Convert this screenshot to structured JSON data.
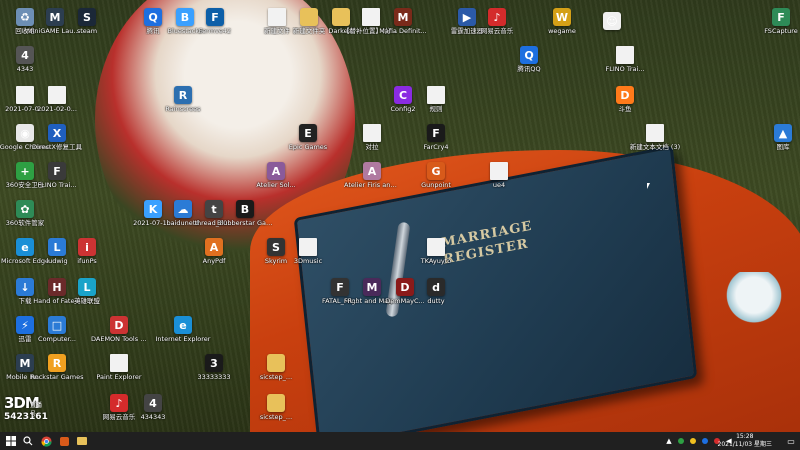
{
  "desktop": {
    "book": {
      "title_line1": "MARRIAGE",
      "title_line2": "REGISTER"
    },
    "icons": [
      {
        "label": "回收站",
        "type": "app",
        "color": "#6d8fb5",
        "glyph": "♻"
      },
      {
        "label": "MiniGAME Launcher",
        "type": "app",
        "color": "#2c3e50",
        "glyph": "M"
      },
      {
        "label": "steam",
        "type": "app",
        "color": "#1b2838",
        "glyph": "S"
      },
      {
        "label": "腾讯",
        "type": "app",
        "color": "#1d6fe0",
        "glyph": "Q"
      },
      {
        "label": "Bluestacks",
        "type": "app",
        "color": "#3aa0ff",
        "glyph": "B"
      },
      {
        "label": "Fermve42",
        "type": "app",
        "color": "#0d5fa8",
        "glyph": "F"
      },
      {
        "label": "新建文件",
        "type": "file",
        "color": "#f2f2f2",
        "glyph": ""
      },
      {
        "label": "新建文件夹",
        "type": "folder",
        "color": "#e8c15a",
        "glyph": ""
      },
      {
        "label": "Darkest",
        "type": "folder",
        "color": "#e8c15a",
        "glyph": ""
      },
      {
        "label": "【替补位置】(分析版)",
        "type": "file",
        "color": "#f2f2f2",
        "glyph": ""
      },
      {
        "label": "Mafia Definit...",
        "type": "app",
        "color": "#7a2a1a",
        "glyph": "M"
      },
      {
        "label": "雷霆加速器",
        "type": "app",
        "color": "#2b5aa8",
        "glyph": "▶"
      },
      {
        "label": "网易云音乐",
        "type": "app",
        "color": "#d42b2b",
        "glyph": "♪"
      },
      {
        "label": "wegame",
        "type": "app",
        "color": "#d4a017",
        "glyph": "W"
      },
      {
        "label": "",
        "type": "app",
        "color": "#f0f0f0",
        "glyph": "☺"
      },
      {
        "label": "FSCapture",
        "type": "app",
        "color": "#2e8b57",
        "glyph": "F"
      },
      {
        "label": "4343",
        "type": "app",
        "color": "#555555",
        "glyph": "4"
      },
      {
        "label": "腾讯QQ",
        "type": "app",
        "color": "#1d6fe0",
        "glyph": "Q"
      },
      {
        "label": "FLINO Trai...",
        "type": "file",
        "color": "#f2f2f2",
        "glyph": ""
      },
      {
        "label": "2021-07-0...",
        "type": "file",
        "color": "#f2f2f2",
        "glyph": ""
      },
      {
        "label": "2021-02-0...",
        "type": "file",
        "color": "#f2f2f2",
        "glyph": ""
      },
      {
        "label": "Rainscrees",
        "type": "app",
        "color": "#2c6fb0",
        "glyph": "R"
      },
      {
        "label": "Config2",
        "type": "app",
        "color": "#8a2be2",
        "glyph": "C"
      },
      {
        "label": "规则",
        "type": "file",
        "color": "#f2f2f2",
        "glyph": ""
      },
      {
        "label": "斗鱼",
        "type": "app",
        "color": "#ff7a1a",
        "glyph": "D"
      },
      {
        "label": "Google Chrome",
        "type": "app",
        "color": "#e8e8e8",
        "glyph": "◉"
      },
      {
        "label": "DirectX修复工具",
        "type": "app",
        "color": "#1f5fbf",
        "glyph": "X"
      },
      {
        "label": "Epic Games",
        "type": "app",
        "color": "#222222",
        "glyph": "E"
      },
      {
        "label": "对拉",
        "type": "file",
        "color": "#f2f2f2",
        "glyph": ""
      },
      {
        "label": "FarCry4",
        "type": "app",
        "color": "#1a1a1a",
        "glyph": "F"
      },
      {
        "label": "新建文本文档 (3)",
        "type": "file",
        "color": "#f2f2f2",
        "glyph": ""
      },
      {
        "label": "图库",
        "type": "app",
        "color": "#2b7bd6",
        "glyph": "▲"
      },
      {
        "label": "360安全卫士",
        "type": "app",
        "color": "#2ea043",
        "glyph": "+"
      },
      {
        "label": "FLINO Trai...",
        "type": "app",
        "color": "#3a3a3a",
        "glyph": "F"
      },
      {
        "label": "Atelier Sol...",
        "type": "app",
        "color": "#8a5a9a",
        "glyph": "A"
      },
      {
        "label": "Atelier Firis and Sophie",
        "type": "app",
        "color": "#b07aa0",
        "glyph": "A"
      },
      {
        "label": "Gunpoint",
        "type": "app",
        "color": "#d85a1a",
        "glyph": "G"
      },
      {
        "label": "ue4",
        "type": "file",
        "color": "#e8c15a",
        "glyph": ""
      },
      {
        "label": "360软件管家",
        "type": "app",
        "color": "#2e8b57",
        "glyph": "✿"
      },
      {
        "label": "2021-07-1...",
        "type": "app",
        "color": "#3aa0ff",
        "glyph": "K"
      },
      {
        "label": "baidunetd",
        "type": "app",
        "color": "#2b7bd6",
        "glyph": "☁"
      },
      {
        "label": "thread_30...",
        "type": "app",
        "color": "#444444",
        "glyph": "t"
      },
      {
        "label": "Blubberstar Gaming",
        "type": "app",
        "color": "#1a1a1a",
        "glyph": "B"
      },
      {
        "label": "Microsoft Edge",
        "type": "app",
        "color": "#1a8fd6",
        "glyph": "e"
      },
      {
        "label": "ludwig",
        "type": "app",
        "color": "#2b7bd6",
        "glyph": "L"
      },
      {
        "label": "ifunPs",
        "type": "app",
        "color": "#c33",
        "glyph": "i"
      },
      {
        "label": "AnyPdf",
        "type": "app",
        "color": "#e07020",
        "glyph": "A"
      },
      {
        "label": "Skyrim",
        "type": "app",
        "color": "#333333",
        "glyph": "S"
      },
      {
        "label": "3Dmusic",
        "type": "file",
        "color": "#f2f2f2",
        "glyph": ""
      },
      {
        "label": "TKAyuyto",
        "type": "file",
        "color": "#f2f2f2",
        "glyph": ""
      },
      {
        "label": "下载",
        "type": "app",
        "color": "#2b7bd6",
        "glyph": "↓"
      },
      {
        "label": "Hand of Fate 2",
        "type": "app",
        "color": "#6b2a2a",
        "glyph": "H"
      },
      {
        "label": "英雄联盟",
        "type": "app",
        "color": "#1aa3c9",
        "glyph": "L"
      },
      {
        "label": "Might and Magic H...",
        "type": "app",
        "color": "#4a2a5a",
        "glyph": "M"
      },
      {
        "label": "DemMayC...",
        "type": "app",
        "color": "#8a1a1a",
        "glyph": "D"
      },
      {
        "label": "dutty",
        "type": "app",
        "color": "#2a2a2a",
        "glyph": "d"
      },
      {
        "label": "FATAL_FR...",
        "type": "app",
        "color": "#333333",
        "glyph": "F"
      },
      {
        "label": "迅雷",
        "type": "app",
        "color": "#1d6fe0",
        "glyph": "⚡"
      },
      {
        "label": "Computer...",
        "type": "app",
        "color": "#2b7bd6",
        "glyph": "□"
      },
      {
        "label": "DAEMON Tools Lite",
        "type": "app",
        "color": "#cc3333",
        "glyph": "D"
      },
      {
        "label": "Internet Explorer",
        "type": "app",
        "color": "#1a8fd6",
        "glyph": "e"
      },
      {
        "label": "Mobile Re...",
        "type": "app",
        "color": "#2c3e50",
        "glyph": "M"
      },
      {
        "label": "Rockstar Games",
        "type": "app",
        "color": "#f0a020",
        "glyph": "R"
      },
      {
        "label": "Paint Explorer",
        "type": "file",
        "color": "#f2f2f2",
        "glyph": ""
      },
      {
        "label": "33333333",
        "type": "app",
        "color": "#1a1a1a",
        "glyph": "3"
      },
      {
        "label": "sicstep_...",
        "type": "folder",
        "color": "#e8c15a",
        "glyph": ""
      },
      {
        "label": "网易云音乐",
        "type": "app",
        "color": "#d42b2b",
        "glyph": "♪"
      },
      {
        "label": "434343",
        "type": "app",
        "color": "#444444",
        "glyph": "4"
      },
      {
        "label": "sicstep_...",
        "type": "folder",
        "color": "#e8c15a",
        "glyph": ""
      }
    ]
  },
  "watermark": {
    "logo": "3DM",
    "sub": "直播号",
    "number": "5423161"
  },
  "taskbar": {
    "start_icon": "windows-logo",
    "search_icon": "search",
    "time": "15:28",
    "date": "2021/11/03 星期三"
  }
}
